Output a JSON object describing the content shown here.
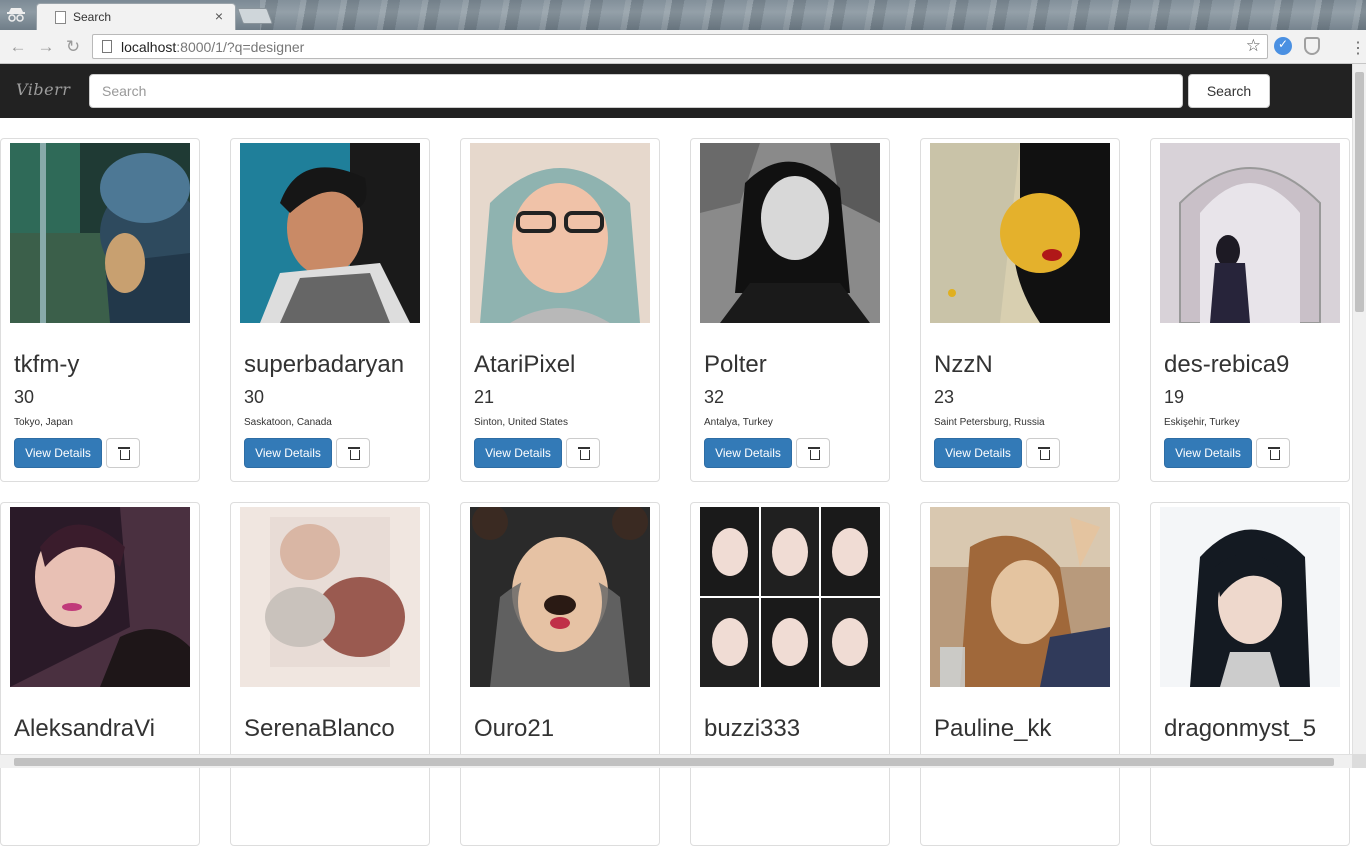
{
  "browser": {
    "tab_title": "Search",
    "tab_close": "×",
    "url_host": "localhost",
    "url_rest": ":8000/1/?q=designer",
    "star": "☆",
    "back": "←",
    "forward": "→",
    "reload": "↻",
    "menu": "⋮"
  },
  "navbar": {
    "brand": "Viberr",
    "search_placeholder": "Search",
    "search_button": "Search"
  },
  "cards": [
    {
      "name": "tkfm-y",
      "age": "30",
      "location": "Tokyo, Japan",
      "view": "View Details"
    },
    {
      "name": "superbadaryan",
      "age": "30",
      "location": "Saskatoon, Canada",
      "view": "View Details"
    },
    {
      "name": "AtariPixel",
      "age": "21",
      "location": "Sinton, United States",
      "view": "View Details"
    },
    {
      "name": "Polter",
      "age": "32",
      "location": "Antalya, Turkey",
      "view": "View Details"
    },
    {
      "name": "NzzN",
      "age": "23",
      "location": "Saint Petersburg, Russia",
      "view": "View Details"
    },
    {
      "name": "des-rebica9",
      "age": "19",
      "location": "Eskişehir, Turkey",
      "view": "View Details"
    },
    {
      "name": "AleksandraVi"
    },
    {
      "name": "SerenaBlanco"
    },
    {
      "name": "Ouro21"
    },
    {
      "name": "buzzi333"
    },
    {
      "name": "Pauline_kk"
    },
    {
      "name": "dragonmyst_5"
    }
  ]
}
